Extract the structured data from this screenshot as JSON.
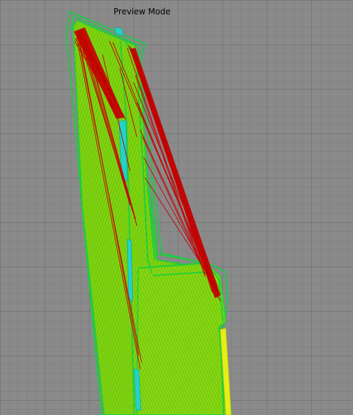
{
  "viewport": {
    "mode_label": "Preview Mode"
  },
  "colors": {
    "background": "#8a8a8a",
    "grid_minor": "#7c7c7c",
    "grid_major": "#6f6f6f",
    "infill": "#7fd40f",
    "infill_dark": "#4a9a16",
    "perimeter": "#1fcf3a",
    "skirt": "#22c84b",
    "support": "#22d3c8",
    "travel": "#c40000",
    "top_skin": "#e6ee15"
  }
}
